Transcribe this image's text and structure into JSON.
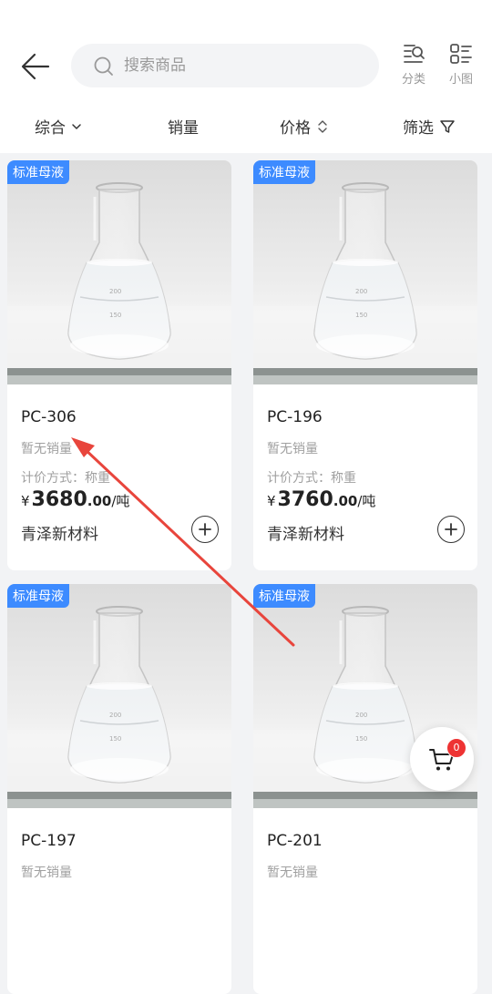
{
  "search": {
    "placeholder": "搜索商品"
  },
  "header_actions": [
    {
      "label": "分类",
      "icon": "category-search-icon"
    },
    {
      "label": "小图",
      "icon": "list-view-icon"
    }
  ],
  "sort_tabs": [
    {
      "label": "综合",
      "icon": "chevron-down-icon"
    },
    {
      "label": "销量"
    },
    {
      "label": "价格",
      "icon": "sort-arrows-icon"
    },
    {
      "label": "筛选",
      "icon": "filter-icon"
    }
  ],
  "products": [
    {
      "badge": "标准母液",
      "name": "PC-306",
      "sales": "暂无销量",
      "pricing": "计价方式：称重",
      "currency": "¥",
      "price_int": "3680",
      "price_dec": ".00",
      "unit": "/吨",
      "store": "青泽新材料"
    },
    {
      "badge": "标准母液",
      "name": "PC-196",
      "sales": "暂无销量",
      "pricing": "计价方式：称重",
      "currency": "¥",
      "price_int": "3760",
      "price_dec": ".00",
      "unit": "/吨",
      "store": "青泽新材料"
    },
    {
      "badge": "标准母液",
      "name": "PC-197",
      "sales": "暂无销量"
    },
    {
      "badge": "标准母液",
      "name": "PC-201",
      "sales": "暂无销量"
    }
  ],
  "cart": {
    "count": "0"
  },
  "colors": {
    "badge": "#3d8bff",
    "cart_badge": "#ee3333",
    "annotation_arrow": "#e8453c"
  }
}
